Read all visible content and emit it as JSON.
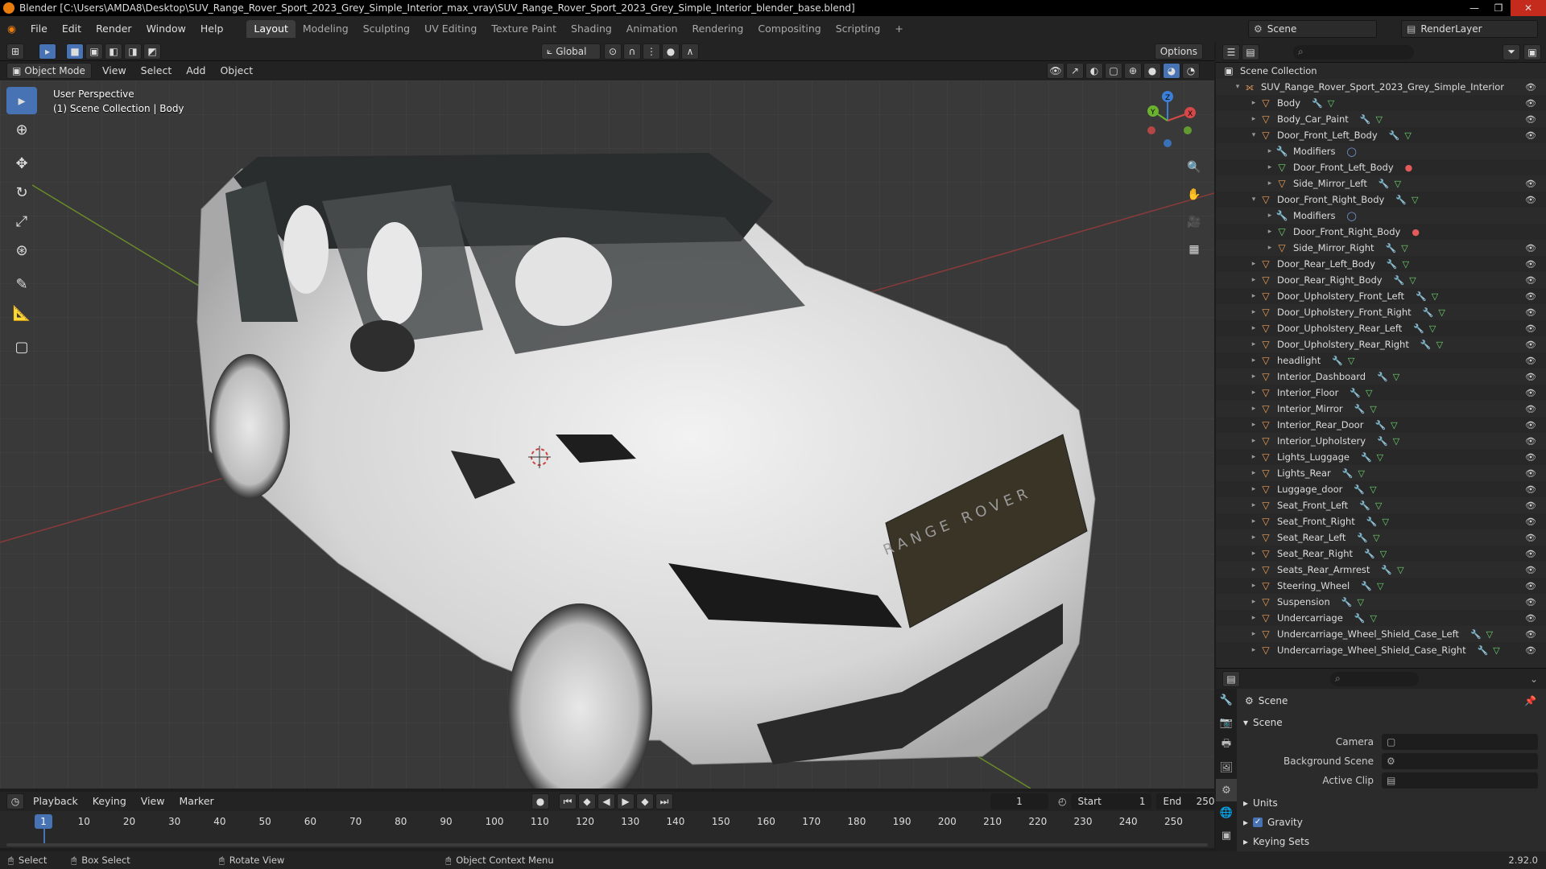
{
  "titlebar": {
    "title": "Blender [C:\\Users\\AMDA8\\Desktop\\SUV_Range_Rover_Sport_2023_Grey_Simple_Interior_max_vray\\SUV_Range_Rover_Sport_2023_Grey_Simple_Interior_blender_base.blend]"
  },
  "menu": {
    "items": [
      "File",
      "Edit",
      "Render",
      "Window",
      "Help"
    ]
  },
  "workspaces": [
    "Layout",
    "Modeling",
    "Sculpting",
    "UV Editing",
    "Texture Paint",
    "Shading",
    "Animation",
    "Rendering",
    "Compositing",
    "Scripting"
  ],
  "topright": {
    "scene": "Scene",
    "renderlayer": "RenderLayer"
  },
  "viewport": {
    "mode": "Object Mode",
    "menus": [
      "View",
      "Select",
      "Add",
      "Object"
    ],
    "transform": "Global",
    "options": "Options",
    "info_line1": "User Perspective",
    "info_line2": "(1) Scene Collection | Body",
    "car_brand": "RANGE ROVER"
  },
  "outliner": {
    "root": "Scene Collection",
    "collection": "SUV_Range_Rover_Sport_2023_Grey_Simple_Interior",
    "rows": [
      {
        "name": "Body",
        "level": 1,
        "arrow": "▸",
        "type": "obj"
      },
      {
        "name": "Body_Car_Paint",
        "level": 1,
        "arrow": "▸",
        "type": "obj"
      },
      {
        "name": "Door_Front_Left_Body",
        "level": 1,
        "arrow": "▾",
        "type": "obj"
      },
      {
        "name": "Modifiers",
        "level": 2,
        "arrow": "▸",
        "type": "mod"
      },
      {
        "name": "Door_Front_Left_Body",
        "level": 2,
        "arrow": "▸",
        "type": "mesh"
      },
      {
        "name": "Side_Mirror_Left",
        "level": 2,
        "arrow": "▸",
        "type": "obj"
      },
      {
        "name": "Door_Front_Right_Body",
        "level": 1,
        "arrow": "▾",
        "type": "obj"
      },
      {
        "name": "Modifiers",
        "level": 2,
        "arrow": "▸",
        "type": "mod"
      },
      {
        "name": "Door_Front_Right_Body",
        "level": 2,
        "arrow": "▸",
        "type": "mesh"
      },
      {
        "name": "Side_Mirror_Right",
        "level": 2,
        "arrow": "▸",
        "type": "obj"
      },
      {
        "name": "Door_Rear_Left_Body",
        "level": 1,
        "arrow": "▸",
        "type": "obj"
      },
      {
        "name": "Door_Rear_Right_Body",
        "level": 1,
        "arrow": "▸",
        "type": "obj"
      },
      {
        "name": "Door_Upholstery_Front_Left",
        "level": 1,
        "arrow": "▸",
        "type": "obj"
      },
      {
        "name": "Door_Upholstery_Front_Right",
        "level": 1,
        "arrow": "▸",
        "type": "obj"
      },
      {
        "name": "Door_Upholstery_Rear_Left",
        "level": 1,
        "arrow": "▸",
        "type": "obj"
      },
      {
        "name": "Door_Upholstery_Rear_Right",
        "level": 1,
        "arrow": "▸",
        "type": "obj"
      },
      {
        "name": "headlight",
        "level": 1,
        "arrow": "▸",
        "type": "obj"
      },
      {
        "name": "Interior_Dashboard",
        "level": 1,
        "arrow": "▸",
        "type": "obj"
      },
      {
        "name": "Interior_Floor",
        "level": 1,
        "arrow": "▸",
        "type": "obj"
      },
      {
        "name": "Interior_Mirror",
        "level": 1,
        "arrow": "▸",
        "type": "obj"
      },
      {
        "name": "Interior_Rear_Door",
        "level": 1,
        "arrow": "▸",
        "type": "obj"
      },
      {
        "name": "Interior_Upholstery",
        "level": 1,
        "arrow": "▸",
        "type": "obj"
      },
      {
        "name": "Lights_Luggage",
        "level": 1,
        "arrow": "▸",
        "type": "obj"
      },
      {
        "name": "Lights_Rear",
        "level": 1,
        "arrow": "▸",
        "type": "obj"
      },
      {
        "name": "Luggage_door",
        "level": 1,
        "arrow": "▸",
        "type": "obj"
      },
      {
        "name": "Seat_Front_Left",
        "level": 1,
        "arrow": "▸",
        "type": "obj"
      },
      {
        "name": "Seat_Front_Right",
        "level": 1,
        "arrow": "▸",
        "type": "obj"
      },
      {
        "name": "Seat_Rear_Left",
        "level": 1,
        "arrow": "▸",
        "type": "obj"
      },
      {
        "name": "Seat_Rear_Right",
        "level": 1,
        "arrow": "▸",
        "type": "obj"
      },
      {
        "name": "Seats_Rear_Armrest",
        "level": 1,
        "arrow": "▸",
        "type": "obj"
      },
      {
        "name": "Steering_Wheel",
        "level": 1,
        "arrow": "▸",
        "type": "obj"
      },
      {
        "name": "Suspension",
        "level": 1,
        "arrow": "▸",
        "type": "obj"
      },
      {
        "name": "Undercarriage",
        "level": 1,
        "arrow": "▸",
        "type": "obj"
      },
      {
        "name": "Undercarriage_Wheel_Shield_Case_Left",
        "level": 1,
        "arrow": "▸",
        "type": "obj"
      },
      {
        "name": "Undercarriage_Wheel_Shield_Case_Right",
        "level": 1,
        "arrow": "▸",
        "type": "obj"
      }
    ]
  },
  "properties": {
    "breadcrumb": "Scene",
    "panel": "Scene",
    "camera_label": "Camera",
    "bg_scene_label": "Background Scene",
    "active_clip_label": "Active Clip",
    "units_label": "Units",
    "gravity_label": "Gravity",
    "keying_label": "Keying Sets"
  },
  "timeline": {
    "menus": [
      "Playback",
      "Keying",
      "View",
      "Marker"
    ],
    "current_frame": "1",
    "start_label": "Start",
    "start": "1",
    "end_label": "End",
    "end": "250",
    "ticks": [
      "10",
      "20",
      "30",
      "40",
      "50",
      "60",
      "70",
      "80",
      "90",
      "100",
      "110",
      "120",
      "130",
      "140",
      "150",
      "160",
      "170",
      "180",
      "190",
      "200",
      "210",
      "220",
      "230",
      "240",
      "250"
    ],
    "cursor": "1"
  },
  "status": {
    "select": "Select",
    "box_select": "Box Select",
    "rotate": "Rotate View",
    "context": "Object Context Menu",
    "version": "2.92.0"
  }
}
